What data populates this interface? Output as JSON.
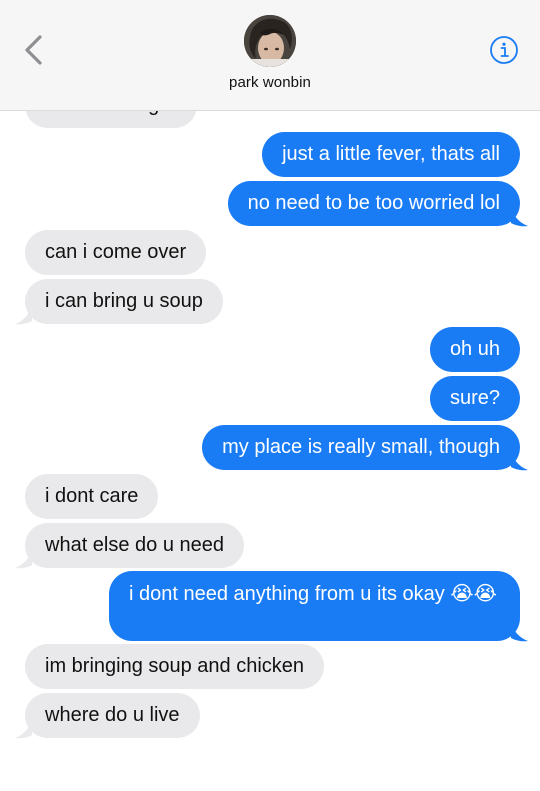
{
  "header": {
    "contact_name": "park wonbin"
  },
  "thread": {
    "partial_top": "whats wrong?",
    "messages": [
      {
        "side": "out",
        "text": "just a little fever, thats all"
      },
      {
        "side": "out",
        "text": "no need to be too worried lol"
      },
      {
        "side": "in",
        "text": "can i come over"
      },
      {
        "side": "in",
        "text": "i can bring u soup"
      },
      {
        "side": "out",
        "text": "oh uh"
      },
      {
        "side": "out",
        "text": "sure?"
      },
      {
        "side": "out",
        "text": "my place is really small, though"
      },
      {
        "side": "in",
        "text": "i dont care"
      },
      {
        "side": "in",
        "text": "what else do u need"
      },
      {
        "side": "out",
        "text": "i dont need anything from u its okay 😭😭"
      },
      {
        "side": "in",
        "text": "im bringing soup and chicken"
      },
      {
        "side": "in",
        "text": "where do u live"
      }
    ]
  },
  "colors": {
    "outgoing": "#1a7cf5",
    "incoming": "#e9e9eb",
    "accent": "#1a7cf5"
  },
  "icons": {
    "back": "chevron-left-icon",
    "info": "info-icon"
  }
}
